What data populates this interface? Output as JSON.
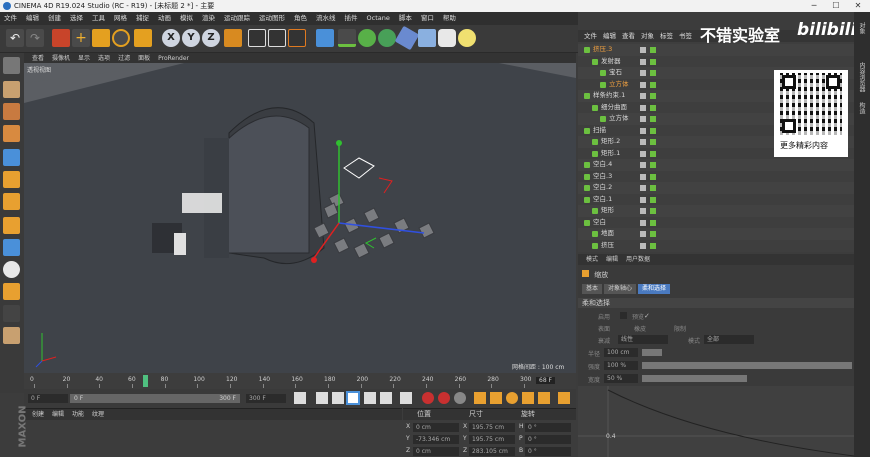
{
  "window": {
    "title": "CINEMA 4D R19.024 Studio (RC - R19) - [未标题 2 *] - 主要",
    "min": "─",
    "max": "☐",
    "close": "✕"
  },
  "menu": [
    "文件",
    "编辑",
    "创建",
    "选择",
    "工具",
    "网格",
    "捕捉",
    "动画",
    "模拟",
    "渲染",
    "运动跟踪",
    "运动图形",
    "角色",
    "流水线",
    "插件",
    "Octane",
    "脚本",
    "窗口",
    "帮助"
  ],
  "toolbar": {
    "axis_x": "X",
    "axis_y": "Y",
    "axis_z": "Z"
  },
  "viewport": {
    "menu": [
      "查看",
      "摄像机",
      "显示",
      "选项",
      "过滤",
      "面板",
      "ProRender"
    ],
    "label": "透视视图",
    "grid_info": "网格间距 : 100 cm"
  },
  "timeline": {
    "ticks": [
      "0",
      "20",
      "40",
      "60",
      "80",
      "100",
      "120",
      "140",
      "160",
      "180",
      "200",
      "220",
      "240",
      "260",
      "280",
      "300"
    ],
    "current": "68 F",
    "playhead": 68,
    "start": "0 F",
    "range_start": "0 F",
    "range_end": "300 F",
    "end": "300 F"
  },
  "materials": {
    "menu": [
      "创建",
      "编辑",
      "功能",
      "纹理"
    ]
  },
  "coords": {
    "headers": [
      "位置",
      "尺寸",
      "旋转"
    ],
    "rows": [
      {
        "a": "X",
        "pos": "0 cm",
        "b": "X",
        "size": "195.75 cm",
        "c": "H",
        "rot": "0 °"
      },
      {
        "a": "Y",
        "pos": "-73.346 cm",
        "b": "Y",
        "size": "195.75 cm",
        "c": "P",
        "rot": "0 °"
      },
      {
        "a": "Z",
        "pos": "0 cm",
        "b": "Z",
        "size": "283.105 cm",
        "c": "B",
        "rot": "0 °"
      }
    ]
  },
  "objects": {
    "menu": [
      "文件",
      "编辑",
      "查看",
      "对象",
      "标签",
      "书签"
    ],
    "rows": [
      {
        "indent": 0,
        "label": "挤压.3",
        "sel": true
      },
      {
        "indent": 1,
        "label": "发射器"
      },
      {
        "indent": 2,
        "label": "宝石"
      },
      {
        "indent": 2,
        "label": "立方体",
        "sel": true
      },
      {
        "indent": 0,
        "label": "样条约束.1"
      },
      {
        "indent": 1,
        "label": "细分曲面"
      },
      {
        "indent": 2,
        "label": "立方体"
      },
      {
        "indent": 0,
        "label": "扫描"
      },
      {
        "indent": 1,
        "label": "矩形.2"
      },
      {
        "indent": 1,
        "label": "矩形.1"
      },
      {
        "indent": 0,
        "label": "空白.4"
      },
      {
        "indent": 0,
        "label": "空白.3"
      },
      {
        "indent": 0,
        "label": "空白.2"
      },
      {
        "indent": 0,
        "label": "空白.1"
      },
      {
        "indent": 1,
        "label": "矩形"
      },
      {
        "indent": 0,
        "label": "空白"
      },
      {
        "indent": 1,
        "label": "地面"
      },
      {
        "indent": 1,
        "label": "挤压"
      }
    ]
  },
  "overlay": {
    "brand": "不错实验室",
    "bilibili": "bilibili",
    "qr_caption": "更多精彩内容"
  },
  "attr": {
    "menu": [
      "模式",
      "编辑",
      "用户数据"
    ],
    "title": "缩放",
    "tabs": [
      "基本",
      "对象轴心",
      "柔和选择"
    ],
    "section": "柔和选择",
    "labels": {
      "enable": "启用",
      "preview": "预览",
      "surface": "表面",
      "rubber": "橡皮",
      "restrict": "限制",
      "falloff": "衰减",
      "falloff_val": "线性",
      "mode": "模式",
      "mode_val": "全部",
      "radius": "半径",
      "radius_val": "100 cm",
      "strength": "强度",
      "strength_val": "100 %",
      "width": "宽度",
      "width_val": "50 %"
    },
    "graph_y": "0.4"
  },
  "rightstrip": [
    "对象",
    "内容浏览器",
    "构造"
  ]
}
